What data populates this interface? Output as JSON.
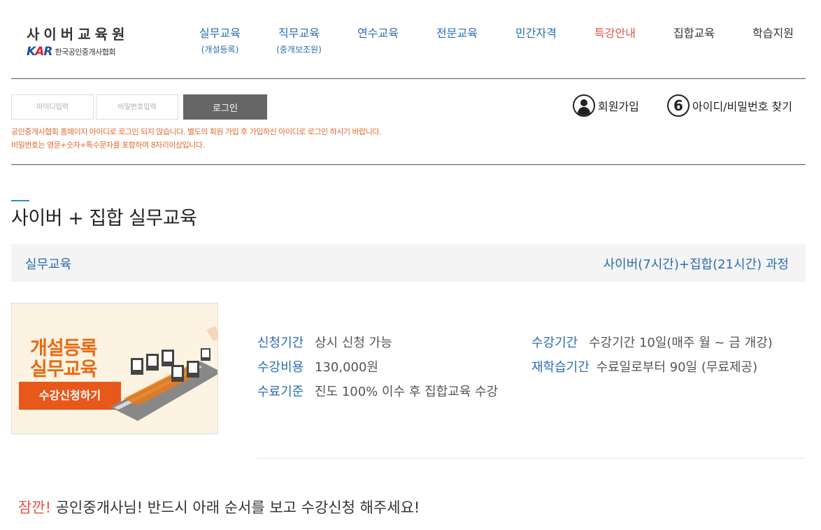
{
  "logo": {
    "title": "사이버교육원",
    "badge": "KAR",
    "association": "한국공인중개사협회"
  },
  "nav": [
    {
      "label": "실무교육",
      "sub": "(개설등록)"
    },
    {
      "label": "직무교육",
      "sub": "(중개보조원)"
    },
    {
      "label": "연수교육",
      "sub": ""
    },
    {
      "label": "전문교육",
      "sub": ""
    },
    {
      "label": "민간자격",
      "sub": ""
    },
    {
      "label": "특강안내",
      "sub": ""
    },
    {
      "label": "집합교육",
      "sub": ""
    },
    {
      "label": "학습지원",
      "sub": ""
    }
  ],
  "login": {
    "id_placeholder": "아이디입력",
    "pw_placeholder": "비밀번호입력",
    "button": "로그인",
    "note_line1": "공인중개사협회 홈페이지 아이디로 로그인 되지 않습니다. 별도의 회원 가입 후 가입하신 아이디로 로그인 하시기 바랍니다.",
    "note_line2": "비밀번호는 영문+숫자+특수문자를 포함하여 8자리이상입니다.",
    "join": "회원가입",
    "find": "아이디/비밀번호 찾기"
  },
  "page_title": "사이버 + 집합 실무교육",
  "course": {
    "category": "실무교육",
    "course_name": "사이버(7시간)+집합(21시간) 과정"
  },
  "banner": {
    "line1": "개설등록",
    "line2": "실무교육",
    "button": "수강신청하기"
  },
  "info": {
    "apply_label": "신청기간",
    "apply_value": "상시 신청 가능",
    "period_label": "수강기간",
    "period_value": "수강기간 10일(매주 월 ~ 금 개강)",
    "fee_label": "수강비용",
    "fee_value": "130,000원",
    "relearn_label": "재학습기간",
    "relearn_value": "수료일로부터 90일 (무료제공)",
    "complete_label": "수료기준",
    "complete_value": "진도 100% 이수 후 집합교육 수강"
  },
  "notice": {
    "emphasis": "잠깐!",
    "text": " 공인중개사님! 반드시 아래 순서를 보고 수강신청 해주세요!"
  },
  "colors": {
    "accent_blue": "#2a6db0",
    "accent_red": "#e0534a",
    "note_orange": "#e06a2c",
    "banner_orange": "#e8581a"
  },
  "icons": {
    "join": "person-circle-icon",
    "find": "lock-circle-icon"
  }
}
